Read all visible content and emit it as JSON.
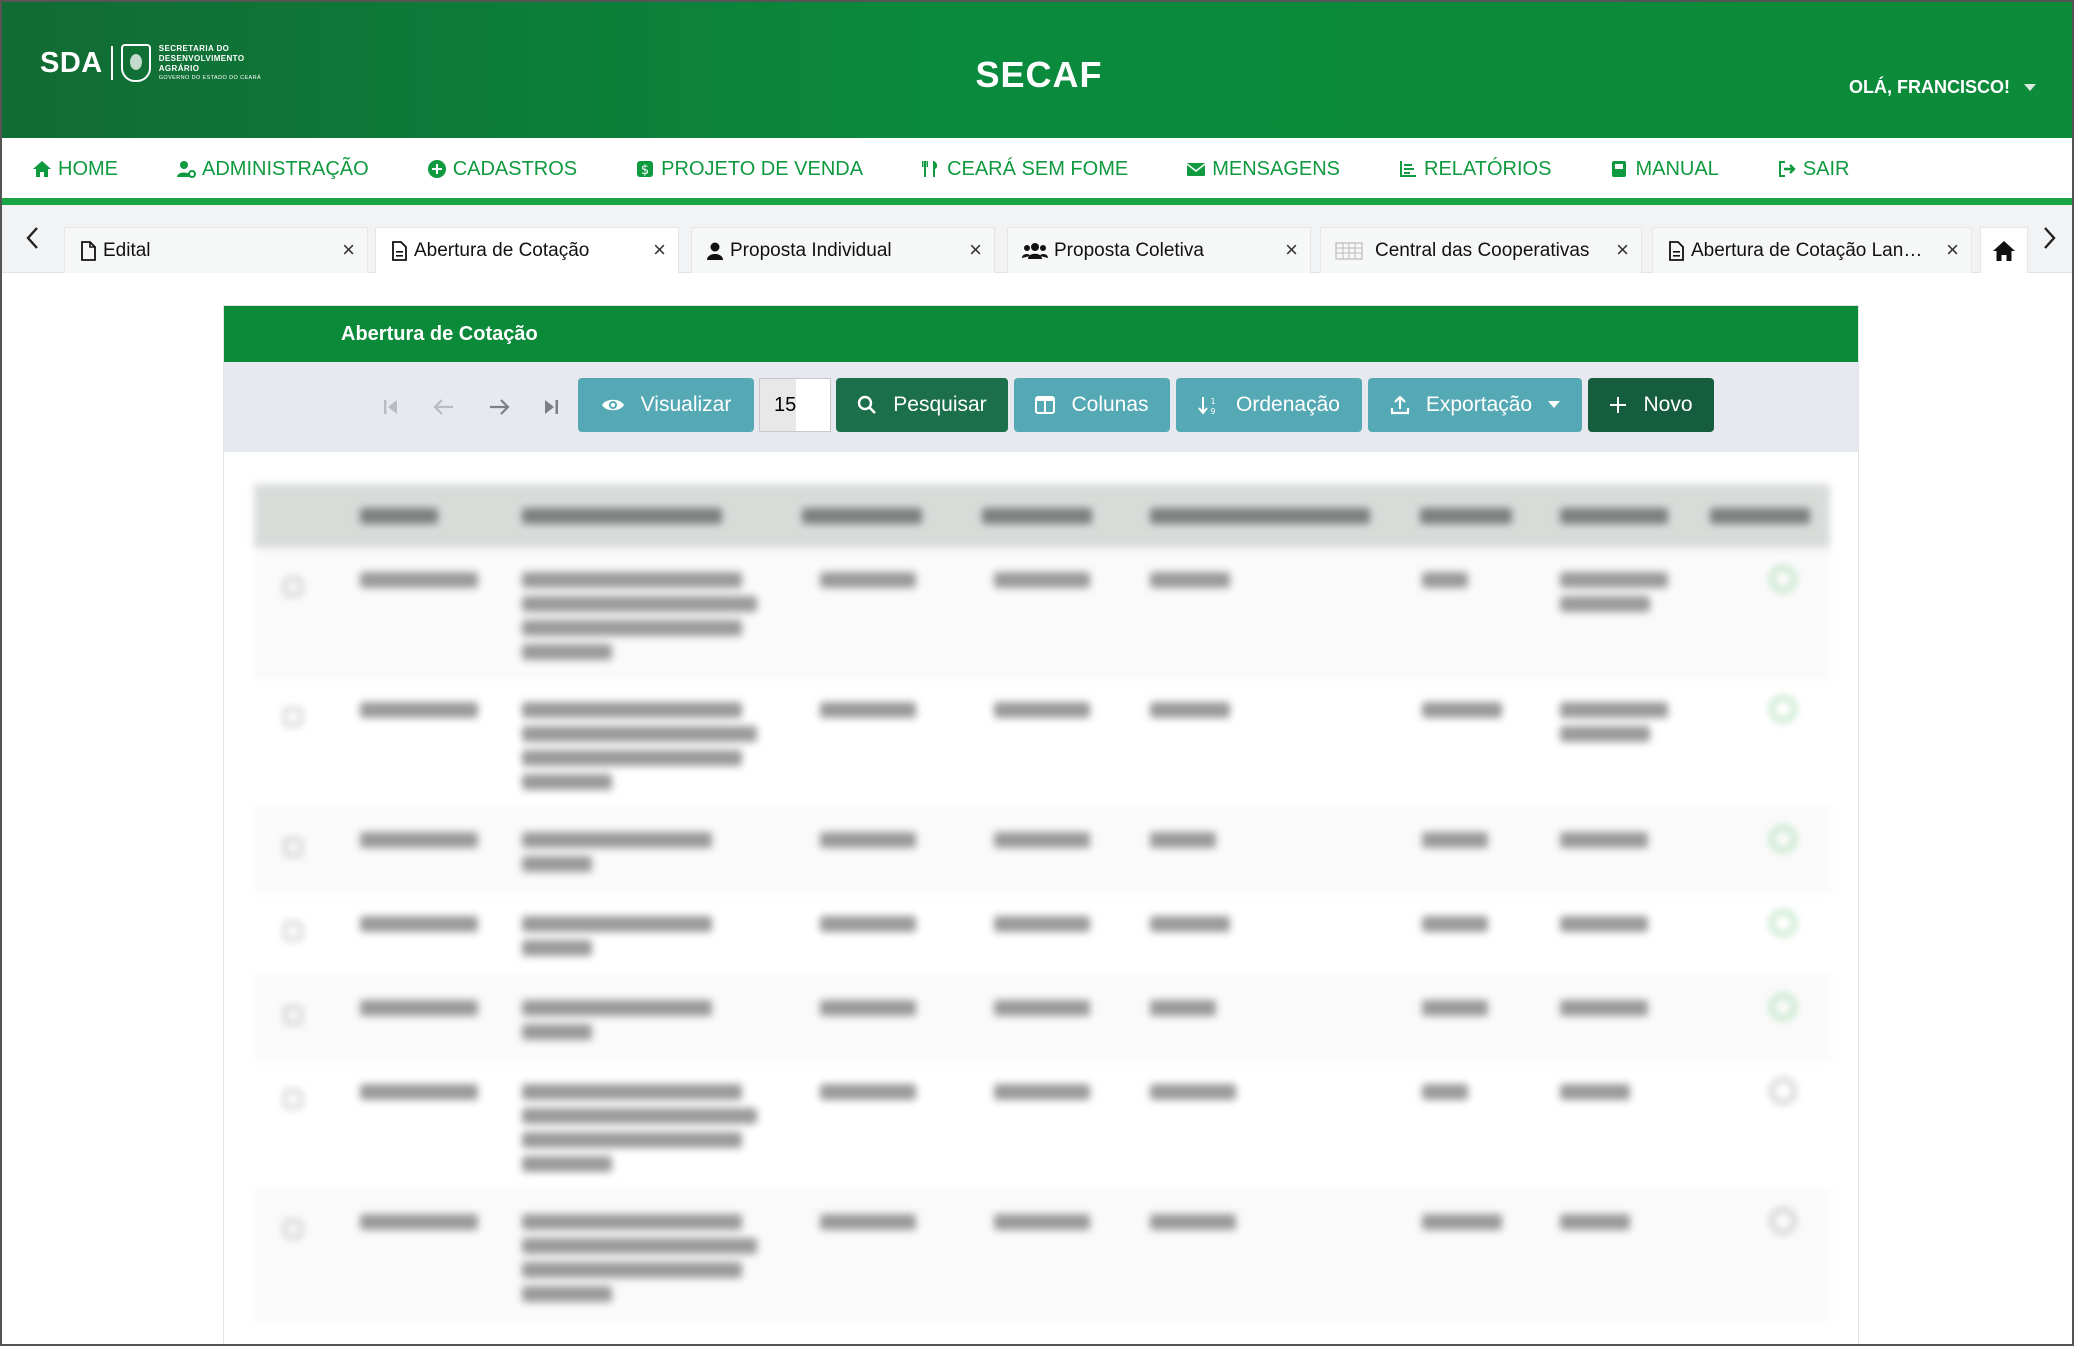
{
  "header": {
    "logo_abbr": "SDA",
    "logo_line1": "SECRETARIA DO",
    "logo_line2": "DESENVOLVIMENTO",
    "logo_line3": "AGRÁRIO",
    "logo_line4": "GOVERNO DO ESTADO DO CEARÁ",
    "app_title": "SECAF",
    "user_greeting": "OLÁ, FRANCISCO!"
  },
  "nav": {
    "items": [
      {
        "label": "HOME",
        "icon": "home-icon"
      },
      {
        "label": "ADMINISTRAÇÃO",
        "icon": "user-gear-icon"
      },
      {
        "label": "CADASTROS",
        "icon": "plus-circle-icon"
      },
      {
        "label": "PROJETO DE VENDA",
        "icon": "dollar-icon"
      },
      {
        "label": "CEARÁ SEM FOME",
        "icon": "utensils-icon"
      },
      {
        "label": "MENSAGENS",
        "icon": "envelope-icon"
      },
      {
        "label": "RELATÓRIOS",
        "icon": "chart-icon"
      },
      {
        "label": "MANUAL",
        "icon": "book-icon"
      },
      {
        "label": "SAIR",
        "icon": "sign-out-icon"
      }
    ]
  },
  "tabs": {
    "items": [
      {
        "label": "Edital",
        "icon": "file-icon"
      },
      {
        "label": "Abertura de Cotação",
        "icon": "file-text-icon"
      },
      {
        "label": "Proposta Individual",
        "icon": "user-icon"
      },
      {
        "label": "Proposta Coletiva",
        "icon": "users-icon"
      },
      {
        "label": "Central das Cooperativas",
        "icon": "table-icon"
      },
      {
        "label": "Abertura de Cotação Lanç...",
        "icon": "file-text-icon"
      }
    ],
    "close_glyph": "×"
  },
  "panel": {
    "title": "Abertura de Cotação",
    "toolbar": {
      "view_label": "Visualizar",
      "page_size": "15",
      "search_label": "Pesquisar",
      "columns_label": "Colunas",
      "order_label": "Ordenação",
      "export_label": "Exportação",
      "new_label": "Novo"
    }
  },
  "colors": {
    "brand_green": "#0b8a3a",
    "nav_green": "#0f9a3f",
    "button_teal": "#55a9b5",
    "button_dark": "#1b6f4b"
  }
}
